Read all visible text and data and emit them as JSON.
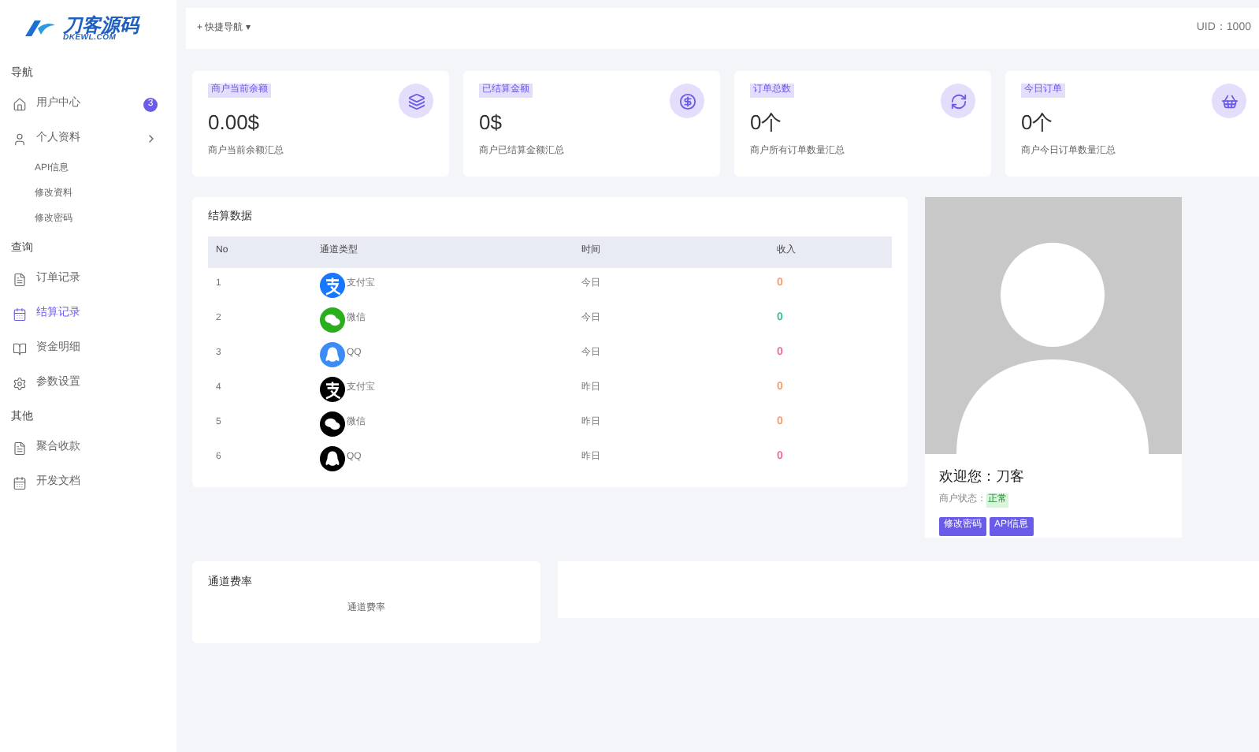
{
  "logo": {
    "name": "刀客源码",
    "domain": "DKEWL.COM"
  },
  "sidebar": {
    "sections": [
      {
        "title": "导航",
        "items": [
          {
            "label": "用户中心",
            "badge": "3",
            "selected": false
          },
          {
            "label": "个人资料",
            "selected": false,
            "expanded": true,
            "children": [
              {
                "label": "API信息"
              },
              {
                "label": "修改资料"
              },
              {
                "label": "修改密码"
              }
            ]
          }
        ]
      },
      {
        "title": "查询",
        "items": [
          {
            "label": "订单记录",
            "selected": false
          },
          {
            "label": "结算记录",
            "selected": true
          },
          {
            "label": "资金明细",
            "selected": false
          },
          {
            "label": "参数设置",
            "selected": false
          }
        ]
      },
      {
        "title": "其他",
        "items": [
          {
            "label": "聚合收款",
            "selected": false
          },
          {
            "label": "开发文档",
            "selected": false
          }
        ]
      }
    ]
  },
  "topbar": {
    "quick_nav": "+ 快捷导航 ▾",
    "uid": "UID：1000"
  },
  "stats": [
    {
      "tag": "商户当前余额",
      "value": "0.00$",
      "note": "商户当前余额汇总"
    },
    {
      "tag": "已结算金额",
      "value": "0$",
      "note": "商户已结算金额汇总"
    },
    {
      "tag": "订单总数",
      "value": "0个",
      "note": "商户所有订单数量汇总"
    },
    {
      "tag": "今日订单",
      "value": "0个",
      "note": "商户今日订单数量汇总"
    }
  ],
  "table": {
    "title": "结算数据",
    "columns": [
      "No",
      "通道类型",
      "时间",
      "收入"
    ],
    "rows": [
      {
        "no": "1",
        "channel": "支付宝",
        "kind": "alipay",
        "today": true,
        "time": "今日",
        "income": "0",
        "color": "#f59e6b"
      },
      {
        "no": "2",
        "channel": "微信",
        "kind": "wechat",
        "today": true,
        "time": "今日",
        "income": "0",
        "color": "#34c3a0"
      },
      {
        "no": "3",
        "channel": "QQ",
        "kind": "qq",
        "today": true,
        "time": "今日",
        "income": "0",
        "color": "#f26d8a"
      },
      {
        "no": "4",
        "channel": "支付宝",
        "kind": "alipay",
        "today": false,
        "time": "昨日",
        "income": "0",
        "color": "#f59e6b"
      },
      {
        "no": "5",
        "channel": "微信",
        "kind": "wechat",
        "today": false,
        "time": "昨日",
        "income": "0",
        "color": "#f59e6b"
      },
      {
        "no": "6",
        "channel": "QQ",
        "kind": "qq",
        "today": false,
        "time": "昨日",
        "income": "0",
        "color": "#f26d8a"
      }
    ]
  },
  "profile": {
    "welcome": "欢迎您：刀客",
    "status_label": "商户状态：",
    "status": "正常",
    "buttons": [
      "修改密码",
      "API信息"
    ]
  },
  "rates": {
    "title": "通道费率",
    "body": "通道费率"
  }
}
